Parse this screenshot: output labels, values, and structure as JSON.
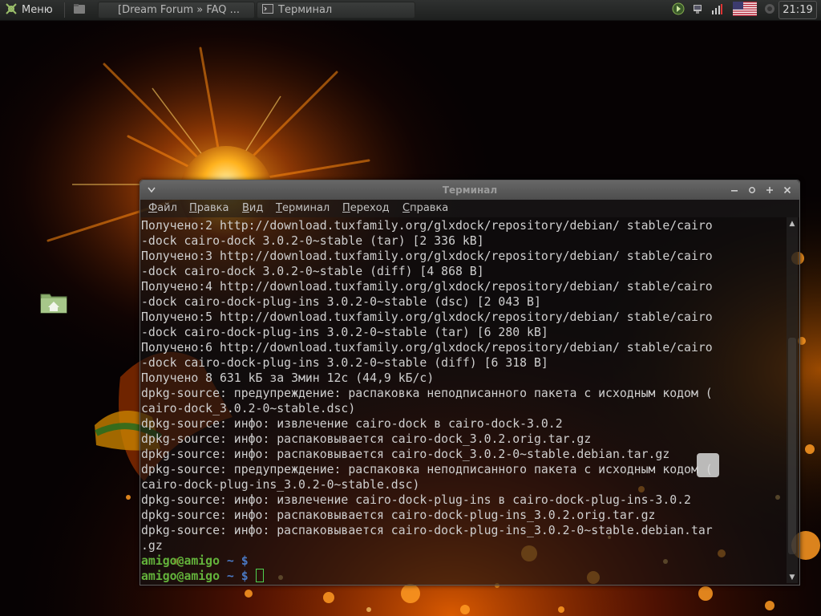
{
  "colors": {
    "panel_bg": "#2a2c2b",
    "terminal_text": "#cfcfcf",
    "prompt_user": "#63b23b",
    "prompt_dir": "#4a78c2",
    "cursor": "#4fd14f"
  },
  "top_panel": {
    "menu_label": "Меню",
    "menu_icon": "mint-logo-icon",
    "launchers": [
      "files-icon",
      "firefox-icon"
    ],
    "tasks": [
      {
        "label": "[Dream Forum » FAQ ...",
        "icon": "firefox-icon",
        "active": false
      },
      {
        "label": "Терминал",
        "icon": "terminal-icon",
        "active": true
      }
    ],
    "tray_icons": [
      "update-manager-icon",
      "network-icon",
      "battery-icon",
      "us-flag-icon",
      "volume-icon"
    ],
    "clock": "21:19"
  },
  "terminal": {
    "title": "Терминал",
    "window_buttons": [
      "minimize",
      "restore",
      "maximize",
      "close"
    ],
    "menu": [
      {
        "label": "Файл",
        "mnemonic": "Ф"
      },
      {
        "label": "Правка",
        "mnemonic": "П"
      },
      {
        "label": "Вид",
        "mnemonic": "В"
      },
      {
        "label": "Терминал",
        "mnemonic": "Т"
      },
      {
        "label": "Переход",
        "mnemonic": "П"
      },
      {
        "label": "Справка",
        "mnemonic": "С"
      }
    ],
    "lines": [
      "Получено:2 http://download.tuxfamily.org/glxdock/repository/debian/ stable/cairo",
      "-dock cairo-dock 3.0.2-0~stable (tar) [2 336 kB]",
      "Получено:3 http://download.tuxfamily.org/glxdock/repository/debian/ stable/cairo",
      "-dock cairo-dock 3.0.2-0~stable (diff) [4 868 B]",
      "Получено:4 http://download.tuxfamily.org/glxdock/repository/debian/ stable/cairo",
      "-dock cairo-dock-plug-ins 3.0.2-0~stable (dsc) [2 043 B]",
      "Получено:5 http://download.tuxfamily.org/glxdock/repository/debian/ stable/cairo",
      "-dock cairo-dock-plug-ins 3.0.2-0~stable (tar) [6 280 kB]",
      "Получено:6 http://download.tuxfamily.org/glxdock/repository/debian/ stable/cairo",
      "-dock cairo-dock-plug-ins 3.0.2-0~stable (diff) [6 318 B]",
      "Получено 8 631 kБ за 3мин 12с (44,9 kБ/с)",
      "dpkg-source: предупреждение: распаковка неподписанного пакета с исходным кодом (",
      "cairo-dock_3.0.2-0~stable.dsc)",
      "dpkg-source: инфо: извлечение cairo-dock в cairo-dock-3.0.2",
      "dpkg-source: инфо: распаковывается cairo-dock_3.0.2.orig.tar.gz",
      "dpkg-source: инфо: распаковывается cairo-dock_3.0.2-0~stable.debian.tar.gz",
      "dpkg-source: предупреждение: распаковка неподписанного пакета с исходным кодом (",
      "cairo-dock-plug-ins_3.0.2-0~stable.dsc)",
      "dpkg-source: инфо: извлечение cairo-dock-plug-ins в cairo-dock-plug-ins-3.0.2",
      "dpkg-source: инфо: распаковывается cairo-dock-plug-ins_3.0.2.orig.tar.gz",
      "dpkg-source: инфо: распаковывается cairo-dock-plug-ins_3.0.2-0~stable.debian.tar",
      ".gz"
    ],
    "prompts": [
      {
        "user": "amigo@amigo",
        "dir": "~",
        "symbol": "$",
        "cursor": false
      },
      {
        "user": "amigo@amigo",
        "dir": "~",
        "symbol": "$",
        "cursor": true
      }
    ]
  },
  "desktop": {
    "icons": [
      "home-folder-icon"
    ]
  }
}
